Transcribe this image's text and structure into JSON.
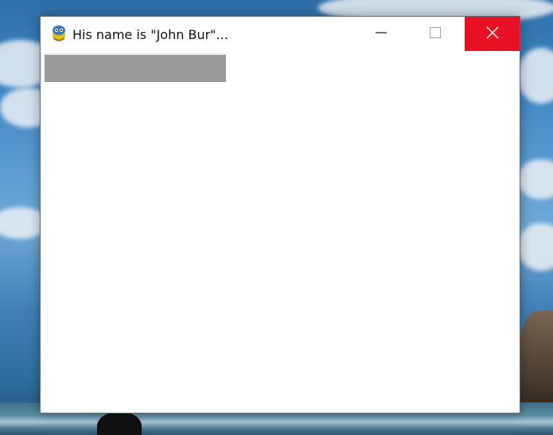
{
  "window": {
    "title": "His name is \"John Bur\"...",
    "app_icon": "pygame-snake-icon",
    "controls": {
      "minimize": "minimize-icon",
      "maximize": "maximize-icon",
      "close": "close-icon",
      "close_color": "#e81123"
    }
  },
  "content": {
    "background": "#ffffff",
    "bar_color": "#9a9a9a"
  }
}
